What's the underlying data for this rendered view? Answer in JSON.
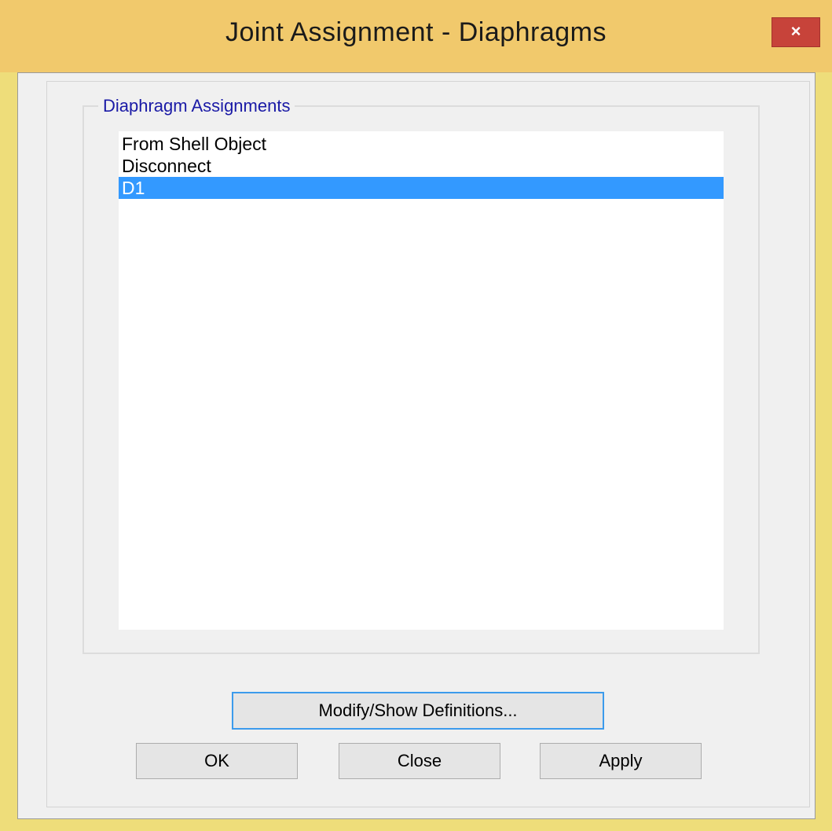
{
  "window": {
    "title": "Joint Assignment - Diaphragms",
    "close_label": "×"
  },
  "group": {
    "label": "Diaphragm Assignments"
  },
  "list": {
    "items": [
      {
        "label": "From Shell Object",
        "selected": false
      },
      {
        "label": "Disconnect",
        "selected": false
      },
      {
        "label": "D1",
        "selected": true
      }
    ]
  },
  "buttons": {
    "modify": "Modify/Show Definitions...",
    "ok": "OK",
    "close": "Close",
    "apply": "Apply"
  },
  "colors": {
    "titlebar": "#f1c96c",
    "selection": "#3399ff",
    "group_label": "#1a1aa6",
    "close_button": "#c7433a"
  }
}
